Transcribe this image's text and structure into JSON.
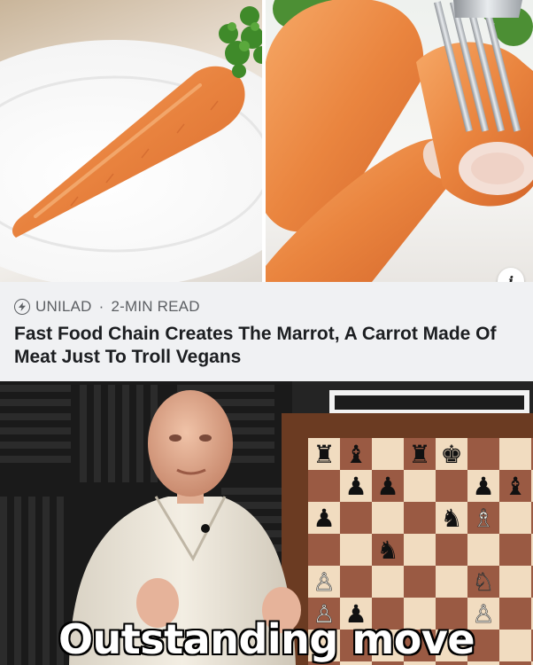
{
  "article": {
    "source_name": "UNILAD",
    "separator": "·",
    "read_time": "2-MIN READ",
    "headline": "Fast Food Chain Creates The Marrot, A Carrot Made Of Meat Just To Troll Vegans",
    "source_icon": "lightning-bolt-icon",
    "info_icon": "info-icon",
    "card_background": "#f0f1f3"
  },
  "photo": {
    "subject": "meat carrot on white plate",
    "carrot_color": "#e8823e",
    "garnish_color": "#3f8a2a"
  },
  "meme": {
    "caption": "Outstanding move",
    "board_light": "#f1dcc0",
    "board_dark": "#9a5a43"
  }
}
